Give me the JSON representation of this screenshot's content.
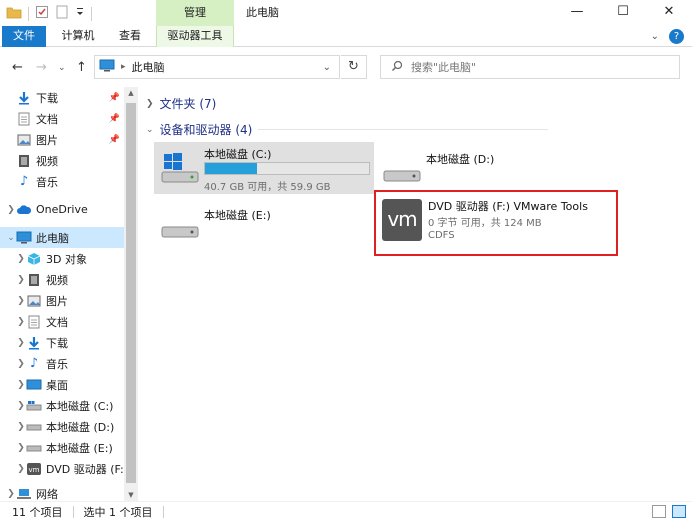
{
  "window": {
    "title": "此电脑",
    "context_tab": "管理",
    "controls": {
      "minimize": "—",
      "maximize": "☐",
      "close": "✕"
    }
  },
  "ribbon": {
    "file": "文件",
    "tabs": [
      "计算机",
      "查看",
      "驱动器工具"
    ],
    "help": "?"
  },
  "address": {
    "path": "此电脑",
    "search_placeholder": "搜索\"此电脑\""
  },
  "nav": {
    "quick": [
      {
        "label": "下载",
        "icon": "download-icon",
        "pinned": true
      },
      {
        "label": "文档",
        "icon": "document-icon",
        "pinned": true
      },
      {
        "label": "图片",
        "icon": "picture-icon",
        "pinned": true
      },
      {
        "label": "视频",
        "icon": "video-icon",
        "pinned": false
      },
      {
        "label": "音乐",
        "icon": "music-icon",
        "pinned": false
      }
    ],
    "onedrive": "OneDrive",
    "thispc": "此电脑",
    "thispc_children": [
      {
        "label": "3D 对象",
        "icon": "3d-objects-icon"
      },
      {
        "label": "视频",
        "icon": "video-icon"
      },
      {
        "label": "图片",
        "icon": "picture-icon"
      },
      {
        "label": "文档",
        "icon": "document-icon"
      },
      {
        "label": "下载",
        "icon": "download-icon"
      },
      {
        "label": "音乐",
        "icon": "music-icon"
      },
      {
        "label": "桌面",
        "icon": "desktop-icon"
      },
      {
        "label": "本地磁盘 (C:)",
        "icon": "drive-icon"
      },
      {
        "label": "本地磁盘 (D:)",
        "icon": "drive-icon"
      },
      {
        "label": "本地磁盘 (E:)",
        "icon": "drive-icon"
      },
      {
        "label": "DVD 驱动器 (F:)",
        "icon": "vmware-icon"
      }
    ],
    "network": "网络"
  },
  "content": {
    "folders_header": "文件夹 (7)",
    "devices_header": "设备和驱动器 (4)",
    "drives": [
      {
        "name": "本地磁盘 (C:)",
        "info": "40.7 GB 可用，共 59.9 GB",
        "used_fraction": 0.32
      },
      {
        "name": "本地磁盘 (D:)"
      },
      {
        "name": "本地磁盘 (E:)"
      }
    ],
    "dvd": {
      "name": "DVD 驱动器 (F:) VMware Tools",
      "info": "0 字节 可用，共 124 MB",
      "fs": "CDFS",
      "logo": "vm"
    }
  },
  "status": {
    "count": "11 个项目",
    "selected": "选中 1 个项目"
  },
  "colors": {
    "accent": "#1979ca",
    "selected": "#cce8ff",
    "context_tab": "#d6f0c4",
    "highlight_box": "#e02020"
  }
}
